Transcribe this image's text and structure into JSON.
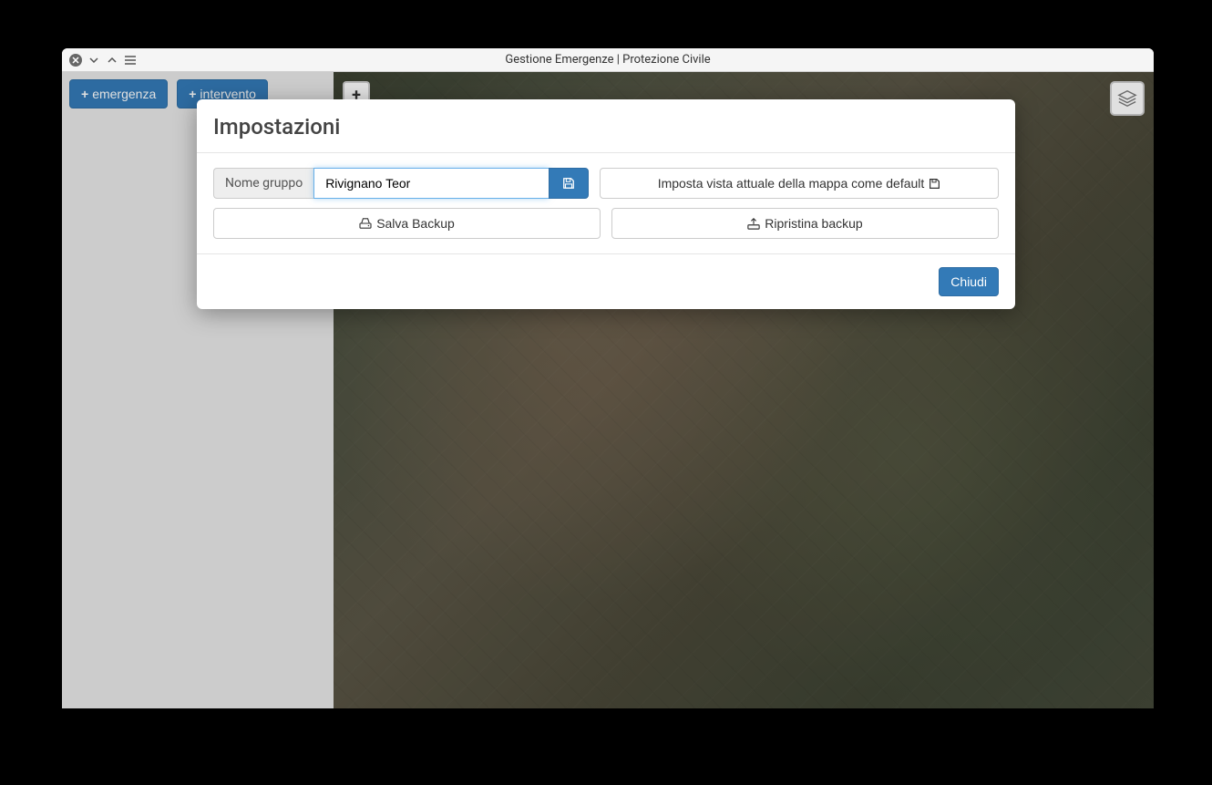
{
  "window": {
    "title": "Gestione Emergenze | Protezione Civile"
  },
  "sidebar": {
    "emergenza_label": "emergenza",
    "intervento_label": "intervento"
  },
  "map": {
    "zoom_in": "+"
  },
  "modal": {
    "title": "Impostazioni",
    "group_label": "Nome gruppo",
    "group_value": "Rivignano Teor",
    "set_default_view": "Imposta vista attuale della mappa come default",
    "save_backup": "Salva Backup",
    "restore_backup": "Ripristina backup",
    "close": "Chiudi"
  }
}
